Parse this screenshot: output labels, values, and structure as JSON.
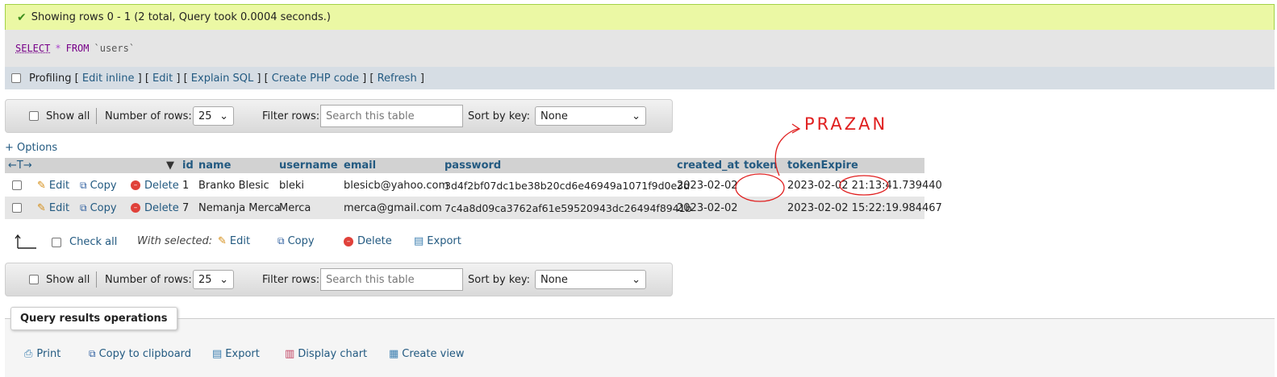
{
  "success": {
    "message": "Showing rows 0 - 1 (2 total, Query took 0.0004 seconds.)"
  },
  "sql": {
    "select": "SELECT",
    "star": "*",
    "from": "FROM",
    "table": "`users`"
  },
  "profiling": {
    "label": "Profiling",
    "links": [
      "Edit inline",
      "Edit",
      "Explain SQL",
      "Create PHP code",
      "Refresh"
    ]
  },
  "navbar": {
    "show_all": "Show all",
    "rows_label": "Number of rows:",
    "rows_value": "25",
    "filter_label": "Filter rows:",
    "filter_placeholder": "Search this table",
    "sort_label": "Sort by key:",
    "sort_value": "None"
  },
  "options_link": "+ Options",
  "table": {
    "arrows": "←T→",
    "columns": [
      "id",
      "name",
      "username",
      "email",
      "password",
      "created_at",
      "token",
      "tokenExpire"
    ],
    "actions": {
      "edit": "Edit",
      "copy": "Copy",
      "delete": "Delete"
    },
    "rows": [
      {
        "id": "1",
        "name": "Branko Blesic",
        "username": "bleki",
        "email": "blesicb@yahoo.com",
        "password": "3d4f2bf07dc1be38b20cd6e46949a1071f9d0e3d",
        "created_at": "2023-02-02",
        "token": "",
        "tokenExpire": "2023-02-02 21:13:41.739440"
      },
      {
        "id": "7",
        "name": "Nemanja Merca",
        "username": "Merca",
        "email": "merca@gmail.com",
        "password": "7c4a8d09ca3762af61e59520943dc26494f8941b",
        "created_at": "2023-02-02",
        "token": "",
        "tokenExpire": "2023-02-02 15:22:19.984467"
      }
    ]
  },
  "bulk": {
    "check_all": "Check all",
    "with_selected": "With selected:",
    "edit": "Edit",
    "copy": "Copy",
    "delete": "Delete",
    "export": "Export"
  },
  "annotation": {
    "text": "PRAZAN",
    "color": "#e02020"
  },
  "operations": {
    "legend": "Query results operations",
    "items": [
      "Print",
      "Copy to clipboard",
      "Export",
      "Display chart",
      "Create view"
    ]
  }
}
